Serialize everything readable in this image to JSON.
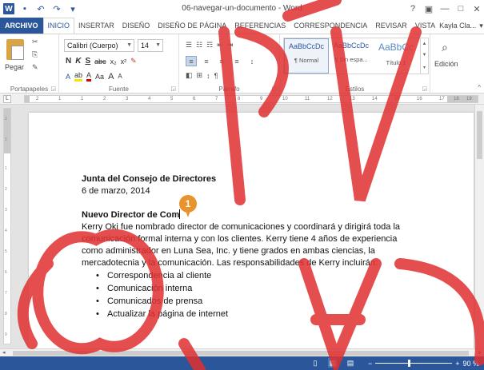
{
  "window": {
    "title": "06-navegar-un-documento - Word",
    "controls": {
      "help": "?",
      "ribbon_display": "▣",
      "minimize": "—",
      "maximize": "□",
      "close": "✕"
    }
  },
  "qat": {
    "logo": "W",
    "save": "▪",
    "undo": "↶",
    "redo": "↷",
    "customize": "▾"
  },
  "tabs": [
    "ARCHIVO",
    "INICIO",
    "INSERTAR",
    "DISEÑO",
    "DISEÑO DE PÁGINA",
    "REFERENCIAS",
    "CORRESPONDENCIA",
    "REVISAR",
    "VISTA"
  ],
  "active_tab": "INICIO",
  "user": {
    "name": "Kayla Cla...",
    "dropdown": "▾"
  },
  "ribbon": {
    "clipboard": {
      "paste_label": "Pegar",
      "group_label": "Portapapeles",
      "cut_icon": "✂",
      "copy_icon": "⎘",
      "format_painter_icon": "✎"
    },
    "font": {
      "family": "Calibri (Cuerpo)",
      "size": "14",
      "grow": "A",
      "shrink": "A",
      "case": "Aa",
      "clear": "✎",
      "bold": "N",
      "italic": "K",
      "underline": "S",
      "strike": "abc",
      "subscript": "x₂",
      "superscript": "x²",
      "effects": "A",
      "highlight": "ab",
      "color": "A",
      "group_label": "Fuente"
    },
    "paragraph": {
      "group_label": "Párrafo",
      "bullets": "☰",
      "numbering": "☷",
      "multilevel": "☶",
      "decrease": "⇤",
      "increase": "⇥",
      "sort": "↕",
      "pilcrow": "¶",
      "shading": "◧",
      "borders": "⊞",
      "line_spacing": "↕"
    },
    "styles": {
      "items": [
        {
          "sample": "AaBbCcDc",
          "name": "¶ Normal"
        },
        {
          "sample": "AaBbCcDc",
          "name": "¶ Sin espa..."
        },
        {
          "sample": "AaBbCc",
          "name": "Título 1"
        }
      ],
      "group_label": "Estilos"
    },
    "editing": {
      "label": "Edición",
      "icon": "⌕"
    },
    "collapse": "^"
  },
  "ruler": {
    "selector": "L",
    "ticks": [
      "2",
      "1",
      "1",
      "2",
      "3",
      "4",
      "5",
      "6",
      "7",
      "8",
      "9",
      "10",
      "11",
      "12",
      "13",
      "14",
      "15",
      "16",
      "17",
      "18",
      "19"
    ]
  },
  "vruler_ticks": [
    "2",
    "1",
    "1",
    "2",
    "3",
    "4",
    "5",
    "6",
    "7",
    "8",
    "9"
  ],
  "document": {
    "heading1": "Junta del Consejo de Directores",
    "date": "6 de marzo, 2014",
    "heading2": "Nuevo Director de Com",
    "body": [
      "Kerry Oki fue nombrado director de comunicaciones y coordinará y dirigirá toda la",
      "comunicación formal interna y con los clientes. Kerry tiene 4 años de experiencia",
      "como administrador en Luna Sea, Inc. y tiene grados en ambas ciencias, la",
      "mercadotecnia y la comunicación. Las responsabilidades de Kerry incluirán:"
    ],
    "bullets": [
      "Correspondencia al cliente",
      "Comunicación interna",
      "Comunicados de prensa",
      "Actualizar la página de internet"
    ],
    "bullet_char": "•"
  },
  "callout": "1",
  "statusbar": {
    "views": [
      "▯",
      "▦",
      "▤"
    ],
    "zoom": {
      "minus": "−",
      "plus": "+",
      "value": "90 %",
      "level_pct": 90
    }
  },
  "hscroll": {
    "left": "◂",
    "right": "▸"
  },
  "watermark": {
    "color": "#e03030"
  },
  "colors": {
    "accent": "#2b579a",
    "callout": "#e8932e"
  }
}
